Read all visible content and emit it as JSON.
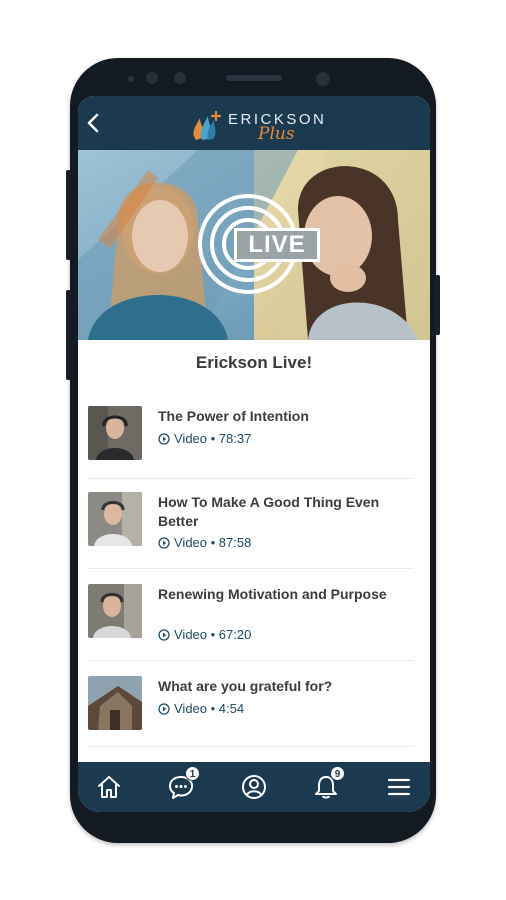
{
  "app": {
    "logo_word": "ERICKSON",
    "logo_plus": "Plus"
  },
  "hero": {
    "badge_text": "LIVE"
  },
  "section": {
    "title": "Erickson Live!"
  },
  "videos": [
    {
      "title": "The Power of Intention",
      "type": "Video",
      "duration": "78:37"
    },
    {
      "title": "How To Make A Good Thing Even Better",
      "type": "Video",
      "duration": "87:58"
    },
    {
      "title": "Renewing Motivation and Purpose",
      "type": "Video",
      "duration": "67:20"
    },
    {
      "title": "What are you grateful for?",
      "type": "Video",
      "duration": "4:54"
    }
  ],
  "nav": {
    "messages_badge": "1",
    "notifications_badge": "9"
  },
  "colors": {
    "header": "#1b3a4f",
    "accent": "#e58a3a",
    "meta": "#1f4b66"
  }
}
